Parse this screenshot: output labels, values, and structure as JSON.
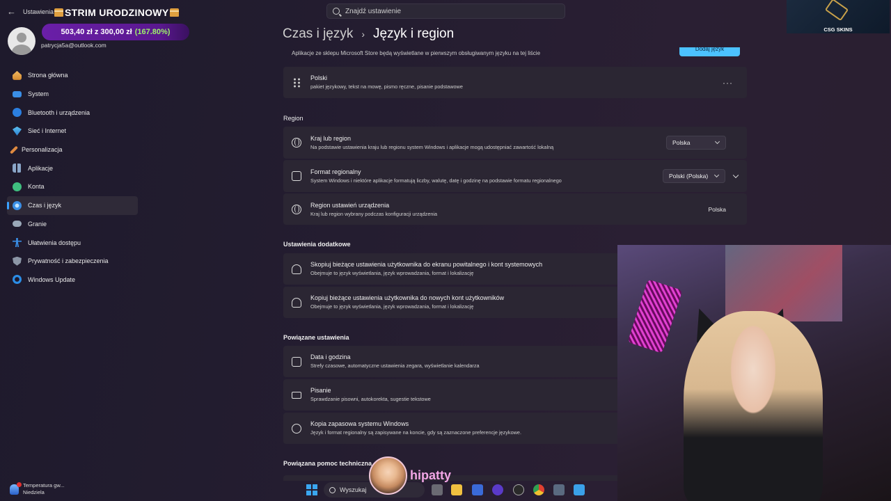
{
  "window": {
    "back_icon": "back-arrow-icon",
    "app_title": "Ustawienia",
    "search_placeholder": "Znajdź ustawienie"
  },
  "stream": {
    "title": "STRIM URODZINOWY",
    "goal_amount": "503,40 zł z 300,00 zł",
    "goal_percent": "(167.80%)",
    "goal_fraction": 1.678,
    "csg_label": "CSG SKINS",
    "streamer_handle": "hipatty"
  },
  "user": {
    "email": "patrycja5a@outlook.com"
  },
  "sidebar": {
    "items": [
      {
        "label": "Strona główna",
        "icon": "home-icon"
      },
      {
        "label": "System",
        "icon": "system-icon"
      },
      {
        "label": "Bluetooth i urządzenia",
        "icon": "bluetooth-icon"
      },
      {
        "label": "Sieć i Internet",
        "icon": "network-icon"
      },
      {
        "label": "Personalizacja",
        "icon": "brush-icon"
      },
      {
        "label": "Aplikacje",
        "icon": "apps-icon"
      },
      {
        "label": "Konta",
        "icon": "account-icon"
      },
      {
        "label": "Czas i język",
        "icon": "time-language-icon",
        "active": true
      },
      {
        "label": "Granie",
        "icon": "gaming-icon"
      },
      {
        "label": "Ułatwienia dostępu",
        "icon": "accessibility-icon"
      },
      {
        "label": "Prywatność i zabezpieczenia",
        "icon": "shield-icon"
      },
      {
        "label": "Windows Update",
        "icon": "update-icon"
      }
    ]
  },
  "main": {
    "breadcrumb_parent": "Czas i język",
    "breadcrumb_sep": "›",
    "breadcrumb_current": "Język i region",
    "store_note": "Aplikacje ze sklepu Microsoft Store będą wyświetlane w pierwszym obsługiwanym języku na tej liście",
    "add_language_button": "Dodaj język",
    "language": {
      "name": "Polski",
      "desc": "pakiet językowy, tekst na mowę, pismo ręczne, pisanie podstawowe",
      "more": "···"
    },
    "region_heading": "Region",
    "region_rows": [
      {
        "title": "Kraj lub region",
        "desc": "Na podstawie ustawienia kraju lub regionu system Windows i aplikacje mogą udostępniać zawartość lokalną",
        "value": "Polska"
      },
      {
        "title": "Format regionalny",
        "desc": "System Windows i niektóre aplikacje formatują liczby, walutę, datę i godzinę na podstawie formatu regionalnego",
        "value": "Polski (Polska)"
      },
      {
        "title": "Region ustawień urządzenia",
        "desc": "Kraj lub region wybrany podczas konfiguracji urządzenia",
        "value": "Polska"
      }
    ],
    "additional_heading": "Ustawienia dodatkowe",
    "additional_rows": [
      {
        "title": "Skopiuj bieżące ustawienia użytkownika do ekranu powitalnego i kont systemowych",
        "desc": "Obejmuje to język wyświetlania, język wprowadzania, format i lokalizację"
      },
      {
        "title": "Kopiuj bieżące ustawienia użytkownika do nowych kont użytkowników",
        "desc": "Obejmuje to język wyświetlania, język wprowadzania, format i lokalizację"
      }
    ],
    "related_heading": "Powiązane ustawienia",
    "related_rows": [
      {
        "title": "Data i godzina",
        "desc": "Strefy czasowe, automatyczne ustawienia zegara, wyświetlanie kalendarza"
      },
      {
        "title": "Pisanie",
        "desc": "Sprawdzanie pisowni, autokorekta, sugestie tekstowe"
      },
      {
        "title": "Kopia zapasowa systemu Windows",
        "desc": "Język i format regionalny są zapisywane na koncie, gdy są zaznaczone preferencje językowe."
      }
    ],
    "help_heading": "Powiązana pomoc techniczna"
  },
  "taskbar": {
    "weather_line1": "Temperatura gw...",
    "weather_line2": "Niedziela",
    "search_label": "Wyszukaj"
  }
}
